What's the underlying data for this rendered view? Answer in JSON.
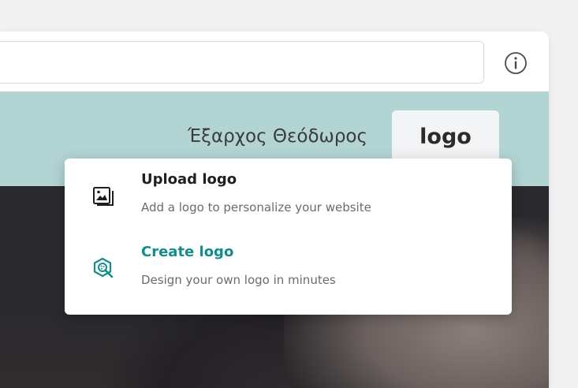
{
  "topbar": {
    "url_value": "",
    "info_icon": "info-circle-icon"
  },
  "header": {
    "site_name": "Έξαρχος Θεόδωρος",
    "logo_button_label": "logo"
  },
  "dropdown": {
    "items": [
      {
        "title": "Upload logo",
        "description": "Add a logo to personalize your website",
        "icon": "image-upload-icon"
      },
      {
        "title": "Create logo",
        "description": "Design your own logo in minutes",
        "icon": "logo-maker-icon"
      }
    ]
  },
  "colors": {
    "header_bg": "#b2d5d4",
    "accent": "#138c8c",
    "logo_button_bg": "#f3f4f6"
  }
}
